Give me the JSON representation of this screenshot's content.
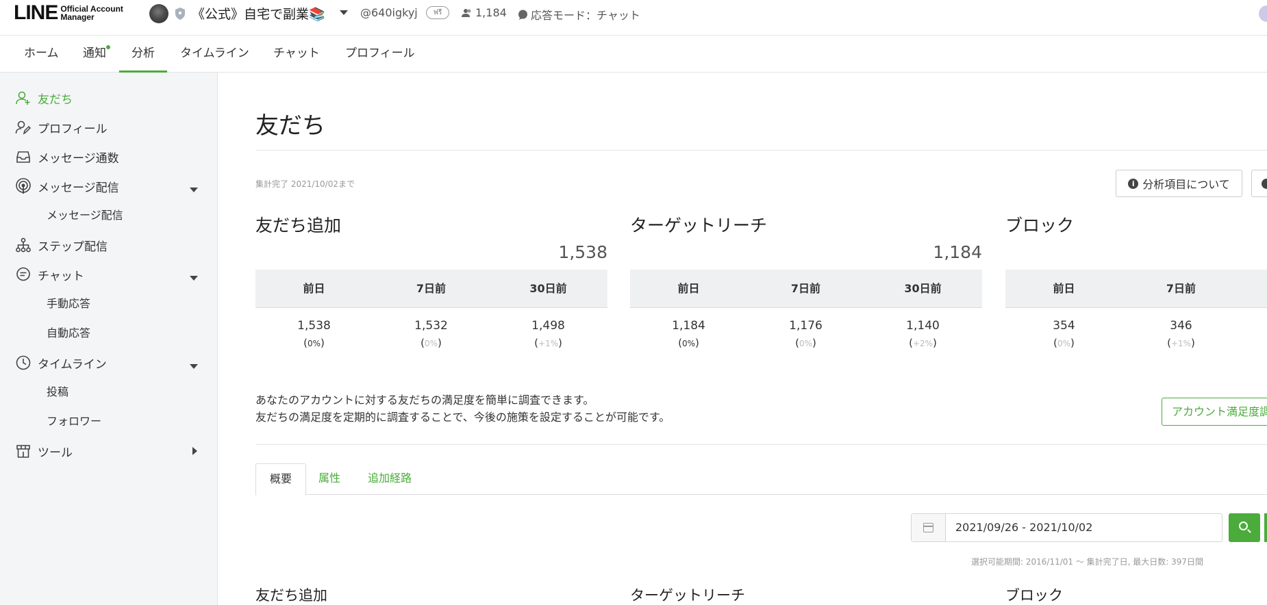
{
  "header": {
    "logo_main": "LINE",
    "logo_sub_1": "Official Account",
    "logo_sub_2": "Manager",
    "account_name": "《公式》自宅で副業📚",
    "account_id": "@640igkyj",
    "plan_badge": "ฟรี",
    "friends_count": "1,184",
    "reply_mode": "応答モード：チャット"
  },
  "nav": {
    "tabs": [
      "ホーム",
      "通知",
      "分析",
      "タイムライン",
      "チャット",
      "プロフィール"
    ],
    "active": "分析"
  },
  "sidebar": {
    "items": [
      {
        "label": "友だち",
        "icon": "friend-add-icon",
        "active": true
      },
      {
        "label": "プロフィール",
        "icon": "profile-edit-icon"
      },
      {
        "label": "メッセージ通数",
        "icon": "inbox-icon"
      },
      {
        "label": "メッセージ配信",
        "icon": "broadcast-icon",
        "expand": "down"
      },
      {
        "label": "メッセージ配信",
        "sub": true
      },
      {
        "label": "ステップ配信",
        "icon": "step-tree-icon"
      },
      {
        "label": "チャット",
        "icon": "chat-icon",
        "expand": "down"
      },
      {
        "label": "手動応答",
        "sub": true
      },
      {
        "label": "自動応答",
        "sub": true
      },
      {
        "label": "タイムライン",
        "icon": "clock-icon",
        "expand": "down"
      },
      {
        "label": "投稿",
        "sub": true
      },
      {
        "label": "フォロワー",
        "sub": true
      },
      {
        "label": "ツール",
        "icon": "store-icon",
        "expand": "right"
      }
    ]
  },
  "main": {
    "title": "友だち",
    "agg_note": "集計完了 2021/10/02まで",
    "analysis_btn": "分析項目について",
    "stats": [
      {
        "title": "友だち追加",
        "total": "1,538",
        "headers": [
          "前日",
          "7日前",
          "30日前"
        ],
        "values": [
          "1,538",
          "1,532",
          "1,498"
        ],
        "pcts": [
          "0%",
          "0%",
          "+1%"
        ]
      },
      {
        "title": "ターゲットリーチ",
        "total": "1,184",
        "headers": [
          "前日",
          "7日前",
          "30日前"
        ],
        "values": [
          "1,184",
          "1,176",
          "1,140"
        ],
        "pcts": [
          "0%",
          "0%",
          "+2%"
        ]
      },
      {
        "title": "ブロック",
        "total": "",
        "headers": [
          "前日",
          "7日前"
        ],
        "values": [
          "354",
          "346"
        ],
        "pcts": [
          "0%",
          "+1%"
        ]
      }
    ],
    "survey_line1": "あなたのアカウントに対する友だちの満足度を簡単に調査できます。",
    "survey_line2": "友だちの満足度を定期的に調査することで、今後の施策を設定することが可能です。",
    "survey_btn": "アカウント満足度調",
    "subtabs": [
      "概要",
      "属性",
      "追加経路"
    ],
    "date_range": "2021/09/26 - 2021/10/02",
    "range_note": "選択可能期間: 2016/11/01 〜 集計完了日, 最大日数: 397日間",
    "bottom_titles": [
      "友だち追加",
      "ターゲットリーチ",
      "ブロック"
    ]
  }
}
